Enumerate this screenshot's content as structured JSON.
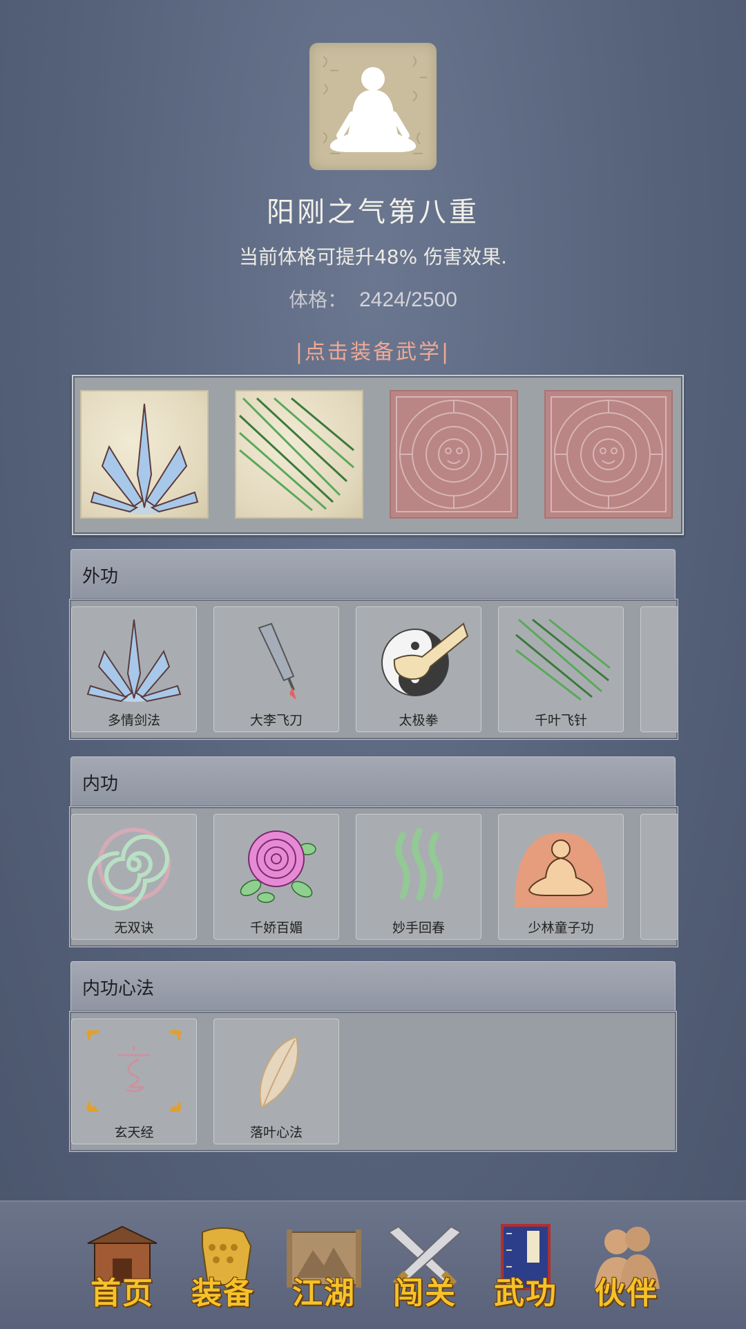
{
  "header": {
    "title": "阳刚之气第八重",
    "description": "当前体格可提升48% 伤害效果.",
    "stat_label": "体格：",
    "stat_value": "2424/2500",
    "equip_link": "|点击装备武学|"
  },
  "equipped": {
    "slots": [
      {
        "icon": "sword-fan-icon",
        "style": "paper"
      },
      {
        "icon": "flying-needles-icon",
        "style": "paper"
      },
      {
        "icon": "empty-slot-seal-icon",
        "style": "stamp"
      },
      {
        "icon": "empty-slot-seal-icon",
        "style": "stamp"
      }
    ]
  },
  "sections": {
    "external": {
      "title": "外功",
      "skills": [
        {
          "label": "多情剑法",
          "icon": "sword-fan-icon"
        },
        {
          "label": "大李飞刀",
          "icon": "flying-knife-icon"
        },
        {
          "label": "太极拳",
          "icon": "taiji-fist-icon"
        },
        {
          "label": "千叶飞针",
          "icon": "flying-needles-icon"
        }
      ]
    },
    "internal": {
      "title": "内功",
      "skills": [
        {
          "label": "无双诀",
          "icon": "spiral-icon"
        },
        {
          "label": "千娇百媚",
          "icon": "rose-icon"
        },
        {
          "label": "妙手回春",
          "icon": "healing-waves-icon"
        },
        {
          "label": "少林童子功",
          "icon": "meditating-monk-icon"
        }
      ]
    },
    "mental": {
      "title": "内功心法",
      "skills": [
        {
          "label": "玄天经",
          "icon": "xuan-glyph-icon"
        },
        {
          "label": "落叶心法",
          "icon": "leaf-icon"
        }
      ]
    }
  },
  "nav": {
    "items": [
      {
        "label": "首页",
        "icon": "temple-icon"
      },
      {
        "label": "装备",
        "icon": "armor-icon"
      },
      {
        "label": "江湖",
        "icon": "map-scroll-icon"
      },
      {
        "label": "闯关",
        "icon": "crossed-swords-icon"
      },
      {
        "label": "武功",
        "icon": "martial-book-icon"
      },
      {
        "label": "伙伴",
        "icon": "companions-icon"
      }
    ]
  },
  "colors": {
    "background": "#56627a",
    "title_text": "#f3f1ea",
    "equip_link": "#f2a994",
    "nav_label": "#f5c22a"
  }
}
